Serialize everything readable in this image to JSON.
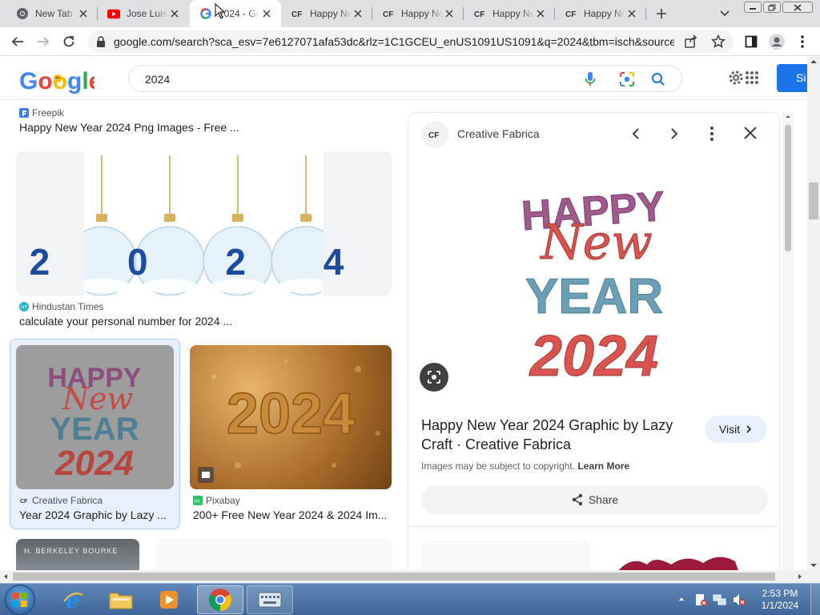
{
  "browser": {
    "tabs": [
      {
        "title": "New Tab",
        "favicon": "chrome-icon"
      },
      {
        "title": "Jose Luis",
        "favicon": "youtube-icon"
      },
      {
        "title": "2024 - Go",
        "favicon": "google-icon"
      },
      {
        "title": "Happy Ne",
        "favicon": "creative-fabrica-icon"
      },
      {
        "title": "Happy Ne",
        "favicon": "creative-fabrica-icon"
      },
      {
        "title": "Happy Ne",
        "favicon": "creative-fabrica-icon"
      },
      {
        "title": "Happy Ne",
        "favicon": "creative-fabrica-icon"
      }
    ],
    "url": "google.com/search?sca_esv=7e6127071afa53dc&rlz=1C1GCEU_enUS1091US1091&q=2024&tbm=isch&source..."
  },
  "search": {
    "query": "2024",
    "signin_label": "Si"
  },
  "results": [
    {
      "source": "Freepik",
      "title": "Happy New Year 2024 Png Images - Free ..."
    },
    {
      "source": "Hindustan Times",
      "title": "calculate your personal number for 2024 ...",
      "image_text": "2 0 2 4"
    },
    {
      "source": "Creative Fabrica",
      "title": "Year 2024 Graphic by Lazy ...",
      "image_lines": [
        "HAPPY",
        "New",
        "YEAR",
        "2024"
      ]
    },
    {
      "source": "Pixabay",
      "title": "200+ Free New Year 2024 & 2024 Im...",
      "image_text": "2024"
    },
    {
      "image_text": "H. BERKELEY BOURKE"
    }
  ],
  "panel": {
    "source": "Creative Fabrica",
    "image_lines": [
      "HAPPY",
      "New",
      "YEAR",
      "2024"
    ],
    "title": "Happy New Year 2024 Graphic by Lazy Craft · Creative Fabrica",
    "visit_label": "Visit",
    "copyright_text": "Images may be subject to copyright.",
    "learn_more": "Learn More",
    "share_label": "Share"
  },
  "taskbar": {
    "time": "2:53 PM",
    "date": "1/1/2024"
  },
  "colors": {
    "google_blue": "#4285f4",
    "accent": "#1a73e8",
    "happy": "#a05a8c",
    "new_red": "#d9534f",
    "year_teal": "#6a9fb5"
  }
}
